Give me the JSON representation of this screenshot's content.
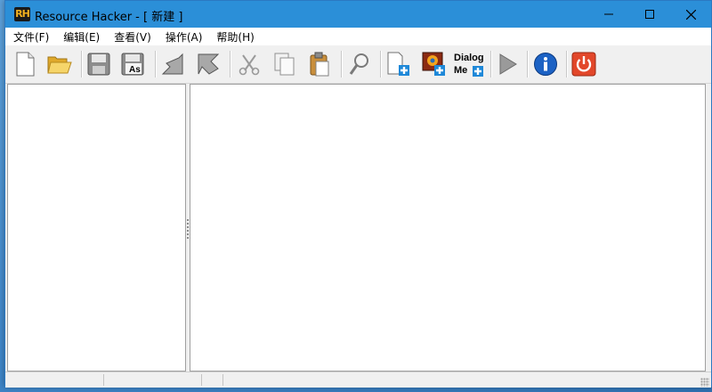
{
  "window": {
    "title": "Resource Hacker - [ 新建 ]",
    "app_icon_text": "RH",
    "controls": [
      "minimize-icon",
      "maximize-icon",
      "close-icon"
    ]
  },
  "menu": [
    {
      "label": "文件(F)"
    },
    {
      "label": "编辑(E)"
    },
    {
      "label": "查看(V)"
    },
    {
      "label": "操作(A)"
    },
    {
      "label": "帮助(H)"
    }
  ],
  "toolbar": {
    "icons": [
      "new-file-icon",
      "open-folder-icon",
      "save-icon",
      "save-as-icon",
      "compile-icon",
      "go-icon",
      "cut-icon",
      "copy-icon",
      "paste-icon",
      "find-icon",
      "add-resource-icon",
      "add-image-resource-icon",
      "dialog-merge-icon",
      "run-script-icon",
      "info-icon",
      "exit-icon"
    ],
    "dialog_line1": "Dialog",
    "dialog_line2": "Me",
    "save_as_badge": "As"
  },
  "status": {
    "segments": [
      "",
      "",
      "",
      ""
    ]
  },
  "colors": {
    "titlebar": "#2b8fd8",
    "exit_button": "#e2472a",
    "info_button": "#1c62c4"
  }
}
